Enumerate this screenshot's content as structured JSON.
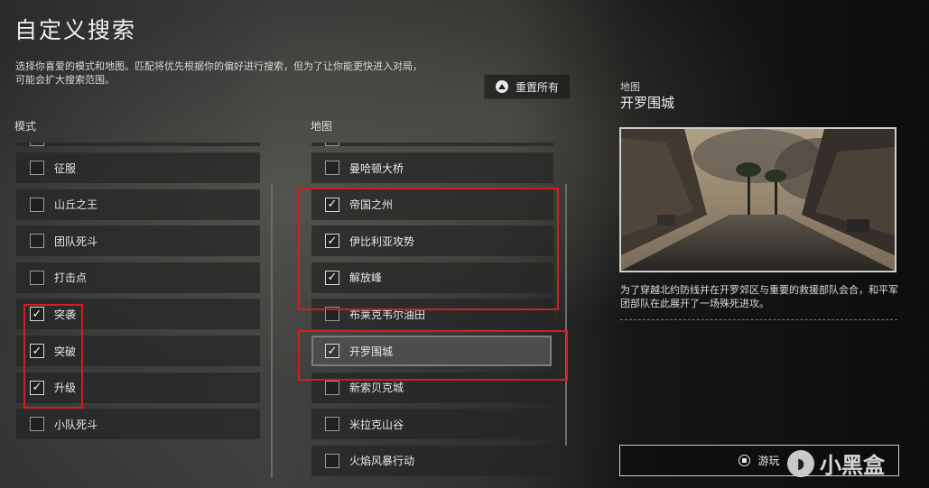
{
  "page": {
    "title": "自定义搜索",
    "description": "选择你喜爱的模式和地图。匹配将优先根据你的偏好进行搜索，但为了让你能更快进入对局，可能会扩大搜索范围。",
    "reset_label": "重置所有"
  },
  "modes": {
    "header": "模式",
    "items": [
      {
        "label": "征服",
        "checked": false
      },
      {
        "label": "山丘之王",
        "checked": false
      },
      {
        "label": "团队死斗",
        "checked": false
      },
      {
        "label": "打击点",
        "checked": false
      },
      {
        "label": "突袭",
        "checked": true
      },
      {
        "label": "突破",
        "checked": true
      },
      {
        "label": "升级",
        "checked": true
      },
      {
        "label": "小队死斗",
        "checked": false
      }
    ]
  },
  "maps": {
    "header": "地图",
    "items": [
      {
        "label": "曼哈顿大桥",
        "checked": false
      },
      {
        "label": "帝国之州",
        "checked": true
      },
      {
        "label": "伊比利亚攻势",
        "checked": true
      },
      {
        "label": "解放峰",
        "checked": true
      },
      {
        "label": "布莱克韦尔油田",
        "checked": false
      },
      {
        "label": "开罗围城",
        "checked": true,
        "selected": true
      },
      {
        "label": "新索贝克城",
        "checked": false
      },
      {
        "label": "米拉克山谷",
        "checked": false
      },
      {
        "label": "火焰风暴行动",
        "checked": false
      }
    ]
  },
  "detail": {
    "category": "地图",
    "name": "开罗围城",
    "description": "为了穿越北约防线并在开罗郊区与重要的救援部队会合，和平军团部队在此展开了一场殊死进攻。",
    "play_label": "游玩"
  },
  "watermark": {
    "text": "小黑盒"
  },
  "colors": {
    "highlight": "#d21c24",
    "checkmark": "#f5f5f5"
  }
}
